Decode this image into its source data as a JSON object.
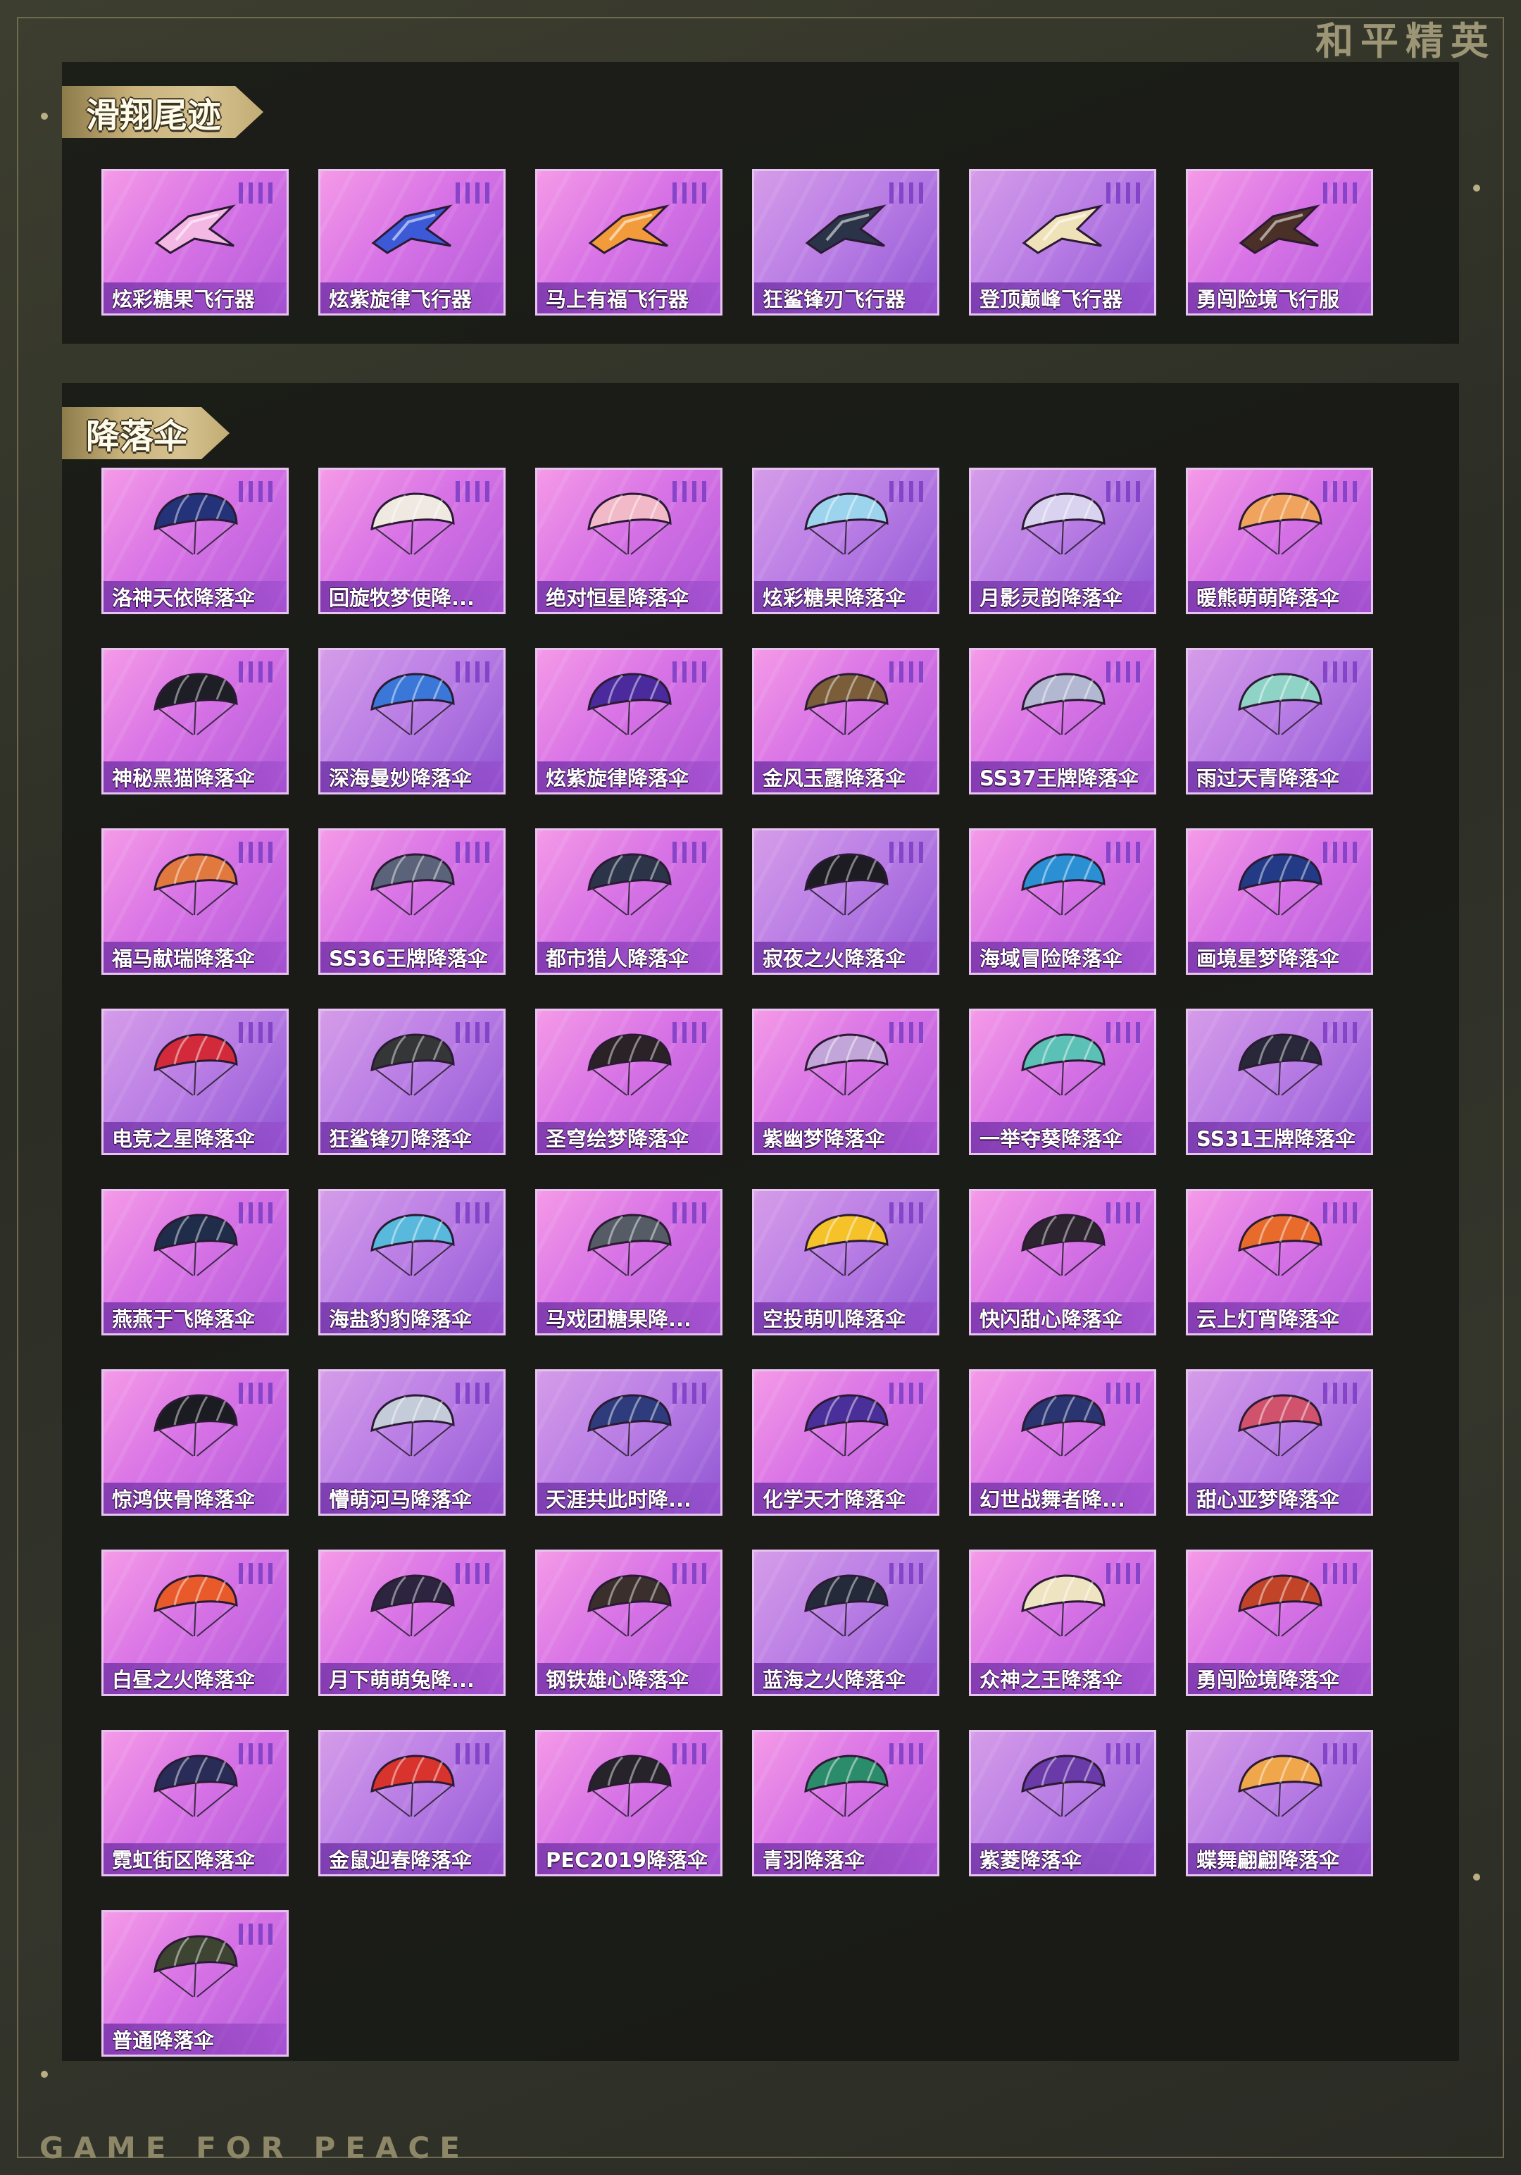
{
  "header": {
    "logo_text": "和平精英"
  },
  "footer": {
    "tagline": "GAME FOR PEACE"
  },
  "sections": [
    {
      "title": "滑翔尾迹",
      "items": [
        {
          "label": "炫彩糖果飞行器",
          "icon": "candy-aircraft-icon",
          "color": "#f3b8e4"
        },
        {
          "label": "炫紫旋律飞行器",
          "icon": "purple-glider-icon",
          "color": "#3c5ad8"
        },
        {
          "label": "马上有福飞行器",
          "icon": "pony-aircraft-icon",
          "color": "#f29b3a"
        },
        {
          "label": "狂鲨锋刃飞行器",
          "icon": "shark-aircraft-icon",
          "color": "#2b3348"
        },
        {
          "label": "登顶巅峰飞行器",
          "icon": "peak-aircraft-icon",
          "color": "#efe2b8"
        },
        {
          "label": "勇闯险境飞行服",
          "icon": "wingsuit-icon",
          "color": "#4a3027"
        }
      ]
    },
    {
      "title": "降落伞",
      "items": [
        {
          "label": "洛神天依降落伞",
          "icon": "parachute-icon",
          "color": "#24327a"
        },
        {
          "label": "回旋牧梦使降...",
          "icon": "parachute-icon",
          "color": "#efe9e2"
        },
        {
          "label": "绝对恒星降落伞",
          "icon": "parachute-icon",
          "color": "#f2b9c9"
        },
        {
          "label": "炫彩糖果降落伞",
          "icon": "parachute-icon",
          "color": "#9cd4ee"
        },
        {
          "label": "月影灵韵降落伞",
          "icon": "parachute-icon",
          "color": "#d9d3f0"
        },
        {
          "label": "暖熊萌萌降落伞",
          "icon": "parachute-icon",
          "color": "#f0a35c"
        },
        {
          "label": "神秘黑猫降落伞",
          "icon": "parachute-icon",
          "color": "#1e1e26"
        },
        {
          "label": "深海曼妙降落伞",
          "icon": "parachute-icon",
          "color": "#3a77d8"
        },
        {
          "label": "炫紫旋律降落伞",
          "icon": "parachute-icon",
          "color": "#4a2a9c"
        },
        {
          "label": "金风玉露降落伞",
          "icon": "parachute-icon",
          "color": "#7b5d3a"
        },
        {
          "label": "SS37王牌降落伞",
          "icon": "parachute-icon",
          "color": "#b3b8d2"
        },
        {
          "label": "雨过天青降落伞",
          "icon": "parachute-icon",
          "color": "#8fd3c6"
        },
        {
          "label": "福马献瑞降落伞",
          "icon": "parachute-icon",
          "color": "#e1783e"
        },
        {
          "label": "SS36王牌降落伞",
          "icon": "parachute-icon",
          "color": "#5b637a"
        },
        {
          "label": "都市猎人降落伞",
          "icon": "parachute-icon",
          "color": "#2c3449"
        },
        {
          "label": "寂夜之火降落伞",
          "icon": "parachute-icon",
          "color": "#1c1c22"
        },
        {
          "label": "海域冒险降落伞",
          "icon": "parachute-icon",
          "color": "#2b8fd4"
        },
        {
          "label": "画境星梦降落伞",
          "icon": "parachute-icon",
          "color": "#233a86"
        },
        {
          "label": "电竞之星降落伞",
          "icon": "parachute-icon",
          "color": "#d22a3a"
        },
        {
          "label": "狂鲨锋刃降落伞",
          "icon": "parachute-icon",
          "color": "#343638"
        },
        {
          "label": "圣穹绘梦降落伞",
          "icon": "parachute-icon",
          "color": "#2a2226"
        },
        {
          "label": "紫幽梦降落伞",
          "icon": "parachute-icon",
          "color": "#c3a6d9"
        },
        {
          "label": "一举夺葵降落伞",
          "icon": "parachute-icon",
          "color": "#5bc0b5"
        },
        {
          "label": "SS31王牌降落伞",
          "icon": "parachute-icon",
          "color": "#28283a"
        },
        {
          "label": "燕燕于飞降落伞",
          "icon": "parachute-icon",
          "color": "#1f2d4a"
        },
        {
          "label": "海盐豹豹降落伞",
          "icon": "parachute-icon",
          "color": "#58b9dc"
        },
        {
          "label": "马戏团糖果降...",
          "icon": "parachute-icon",
          "color": "#565c66"
        },
        {
          "label": "空投萌叽降落伞",
          "icon": "parachute-icon",
          "color": "#f5c22a"
        },
        {
          "label": "快闪甜心降落伞",
          "icon": "parachute-icon",
          "color": "#2c2530"
        },
        {
          "label": "云上灯宵降落伞",
          "icon": "parachute-icon",
          "color": "#e86b2c"
        },
        {
          "label": "惊鸿侠骨降落伞",
          "icon": "parachute-icon",
          "color": "#1b1b22"
        },
        {
          "label": "懵萌河马降落伞",
          "icon": "parachute-icon",
          "color": "#c4ccd9"
        },
        {
          "label": "天涯共此时降...",
          "icon": "parachute-icon",
          "color": "#2e3c7e"
        },
        {
          "label": "化学天才降落伞",
          "icon": "parachute-icon",
          "color": "#4a2f9a"
        },
        {
          "label": "幻世战舞者降...",
          "icon": "parachute-icon",
          "color": "#2a3470"
        },
        {
          "label": "甜心亚梦降落伞",
          "icon": "parachute-icon",
          "color": "#d0526c"
        },
        {
          "label": "白昼之火降落伞",
          "icon": "parachute-icon",
          "color": "#e85a2a"
        },
        {
          "label": "月下萌萌兔降...",
          "icon": "parachute-icon",
          "color": "#2d2440"
        },
        {
          "label": "钢铁雄心降落伞",
          "icon": "parachute-icon",
          "color": "#3a2f2c"
        },
        {
          "label": "蓝海之火降落伞",
          "icon": "parachute-icon",
          "color": "#252a3a"
        },
        {
          "label": "众神之王降落伞",
          "icon": "parachute-icon",
          "color": "#efe4c2"
        },
        {
          "label": "勇闯险境降落伞",
          "icon": "parachute-icon",
          "color": "#c24428"
        },
        {
          "label": "霓虹街区降落伞",
          "icon": "parachute-icon",
          "color": "#2a2c58"
        },
        {
          "label": "金鼠迎春降落伞",
          "icon": "parachute-icon",
          "color": "#d8332c"
        },
        {
          "label": "PEC2019降落伞",
          "icon": "parachute-icon",
          "color": "#26242a"
        },
        {
          "label": "青羽降落伞",
          "icon": "parachute-icon",
          "color": "#2a8c6a"
        },
        {
          "label": "紫菱降落伞",
          "icon": "parachute-icon",
          "color": "#6a3aa8"
        },
        {
          "label": "蝶舞翩翩降落伞",
          "icon": "parachute-icon",
          "color": "#f0a64a"
        },
        {
          "label": "普通降落伞",
          "icon": "parachute-icon",
          "color": "#3e4432"
        }
      ]
    }
  ]
}
